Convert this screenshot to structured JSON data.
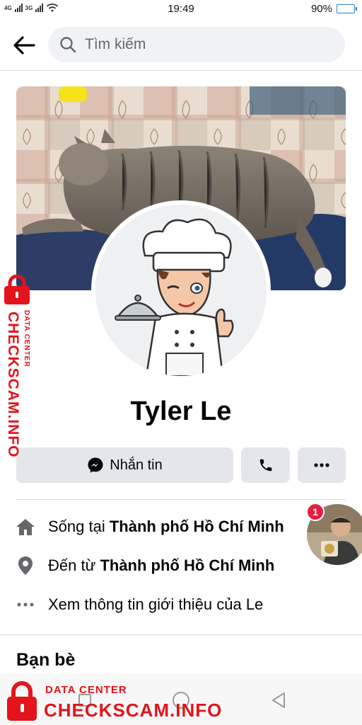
{
  "status_bar": {
    "network_left": "4G",
    "network_right": "3G",
    "time": "19:49",
    "battery": "90%",
    "battery_fraction": 0.9
  },
  "topbar": {
    "back_icon": "arrow-left-icon",
    "search_placeholder": "Tìm kiếm"
  },
  "profile": {
    "name": "Tyler Le",
    "cover_description_icon": "cover-photo",
    "avatar_icon": "chef-avatar"
  },
  "actions": {
    "message_label": "Nhắn tin",
    "message_icon": "messenger-icon",
    "call_icon": "phone-icon",
    "more_icon": "more-icon"
  },
  "intro": {
    "lives_prefix": "Sống tại ",
    "lives_place": "Thành phố Hồ Chí Minh",
    "from_prefix": "Đến từ ",
    "from_place": "Thành phố Hồ Chí Minh",
    "see_about": "Xem thông tin giới thiệu của Le"
  },
  "friends": {
    "title": "Bạn bè"
  },
  "chat_head": {
    "badge_count": "1"
  },
  "watermark": {
    "sub": "DATA CENTER",
    "main": "CHECKSCAM.INFO",
    "color": "#e3141b"
  },
  "colors": {
    "accent": "#1877f2",
    "button_bg": "#e4e6eb",
    "search_bg": "#f0f2f5"
  }
}
